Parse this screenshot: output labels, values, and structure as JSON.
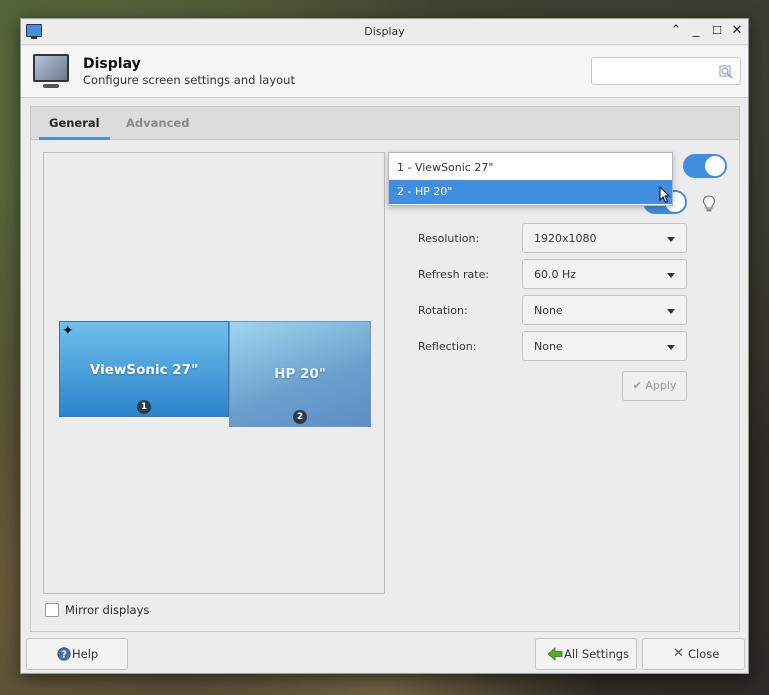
{
  "window": {
    "title": "Display"
  },
  "header": {
    "title": "Display",
    "subtitle": "Configure screen settings and layout",
    "search_placeholder": ""
  },
  "tabs": [
    {
      "label": "General",
      "active": true
    },
    {
      "label": "Advanced",
      "active": false
    }
  ],
  "preview": {
    "screens": [
      {
        "name": "ViewSonic 27\"",
        "number": "1",
        "primary": true
      },
      {
        "name": "HP 20\"",
        "number": "2",
        "primary": false
      }
    ]
  },
  "display_dropdown": {
    "options": [
      "1 - ViewSonic 27\"",
      "2 - HP 20\""
    ],
    "selected_index": 1
  },
  "settings": {
    "resolution": {
      "label": "Resolution:",
      "value": "1920x1080"
    },
    "refresh_rate": {
      "label": "Refresh rate:",
      "value": "60.0 Hz"
    },
    "rotation": {
      "label": "Rotation:",
      "value": "None"
    },
    "reflection": {
      "label": "Reflection:",
      "value": "None"
    },
    "apply_label": "Apply"
  },
  "mirror_displays": {
    "label": "Mirror displays",
    "checked": false
  },
  "footer": {
    "help_label": "Help",
    "all_settings_label": "All Settings",
    "close_label": "Close"
  },
  "colors": {
    "accent": "#3f8ee0",
    "primary_screen": "#2c84cc",
    "secondary_screen": "#6a9fcd"
  },
  "icons": [
    "display-icon",
    "search-icon",
    "lightbulb-icon",
    "help-icon",
    "all-settings-icon",
    "close-icon",
    "checkmark-icon",
    "primary-star-icon"
  ]
}
